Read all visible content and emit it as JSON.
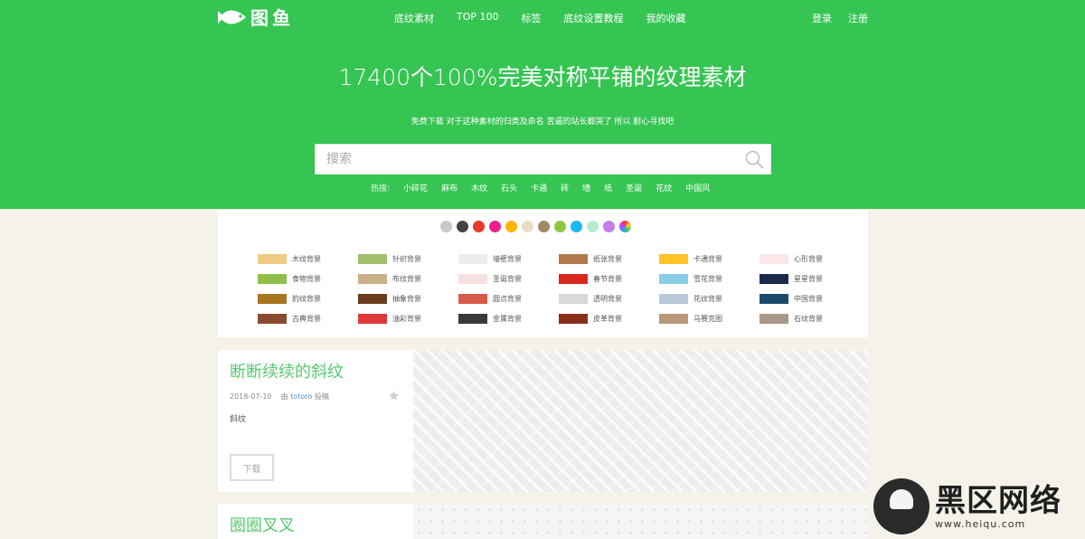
{
  "header": {
    "logo_text": "图鱼",
    "nav": [
      "底纹素材",
      "TOP 100",
      "标签",
      "底纹设置教程",
      "我的收藏"
    ],
    "login": "登录",
    "register": "注册"
  },
  "hero": {
    "title": "17400个100%完美对称平铺的纹理素材",
    "subtitle": "免费下载 对于这种素材的归类及命名 苦逼的站长都哭了 所以 耐心寻找吧",
    "search_placeholder": "搜索",
    "hot_label": "热搜:",
    "hot_tags": [
      "小碎花",
      "麻布",
      "木纹",
      "石头",
      "卡通",
      "砖",
      "墙",
      "纸",
      "圣诞",
      "花纹",
      "中国风"
    ]
  },
  "colors": [
    "#c8c8c8",
    "#444444",
    "#e83a2a",
    "#ee1e8a",
    "#ffb400",
    "#e8dcc4",
    "#a08868",
    "#8bc63f",
    "#1cb9f0",
    "#b4ecd0",
    "#c77ee8",
    "conic"
  ],
  "categories": [
    {
      "label": "木纹背景",
      "swatch": "#f0cc82"
    },
    {
      "label": "针织背景",
      "swatch": "#9fbf6a"
    },
    {
      "label": "墙壁背景",
      "swatch": "#ececec"
    },
    {
      "label": "纸张背景",
      "swatch": "#b07a4a"
    },
    {
      "label": "卡通背景",
      "swatch": "#ffc526"
    },
    {
      "label": "心形背景",
      "swatch": "#fbe6ea"
    },
    {
      "label": "食物背景",
      "swatch": "#8fbf4a"
    },
    {
      "label": "布纹背景",
      "swatch": "#c9b08a"
    },
    {
      "label": "圣诞背景",
      "swatch": "#f6e0e0"
    },
    {
      "label": "春节背景",
      "swatch": "#d8281e"
    },
    {
      "label": "雪花背景",
      "swatch": "#88cde8"
    },
    {
      "label": "星星背景",
      "swatch": "#1a2a4a"
    },
    {
      "label": "豹纹背景",
      "swatch": "#a8761e"
    },
    {
      "label": "抽象背景",
      "swatch": "#6a3c1e"
    },
    {
      "label": "圆点背景",
      "swatch": "#d85a4a"
    },
    {
      "label": "透明背景",
      "swatch": "#d8d8d8"
    },
    {
      "label": "花纹背景",
      "swatch": "#b8c8d8"
    },
    {
      "label": "中国背景",
      "swatch": "#1e4a6a"
    },
    {
      "label": "古典背景",
      "swatch": "#8a4a2e"
    },
    {
      "label": "油彩背景",
      "swatch": "#e03a3a"
    },
    {
      "label": "金属背景",
      "swatch": "#3a3a3a"
    },
    {
      "label": "皮革背景",
      "swatch": "#8a2e1a"
    },
    {
      "label": "马赛克图",
      "swatch": "#b89878"
    },
    {
      "label": "石纹背景",
      "swatch": "#a89888"
    }
  ],
  "articles": [
    {
      "title": "断断续续的斜纹",
      "date": "2018-07-10",
      "by": "由",
      "user": "totoro",
      "posted": "投稿",
      "desc": "斜纹",
      "download": "下载"
    },
    {
      "title": "圈圈叉叉"
    }
  ],
  "watermark": {
    "name": "黑区网络",
    "url": "www.heiqu.com"
  }
}
